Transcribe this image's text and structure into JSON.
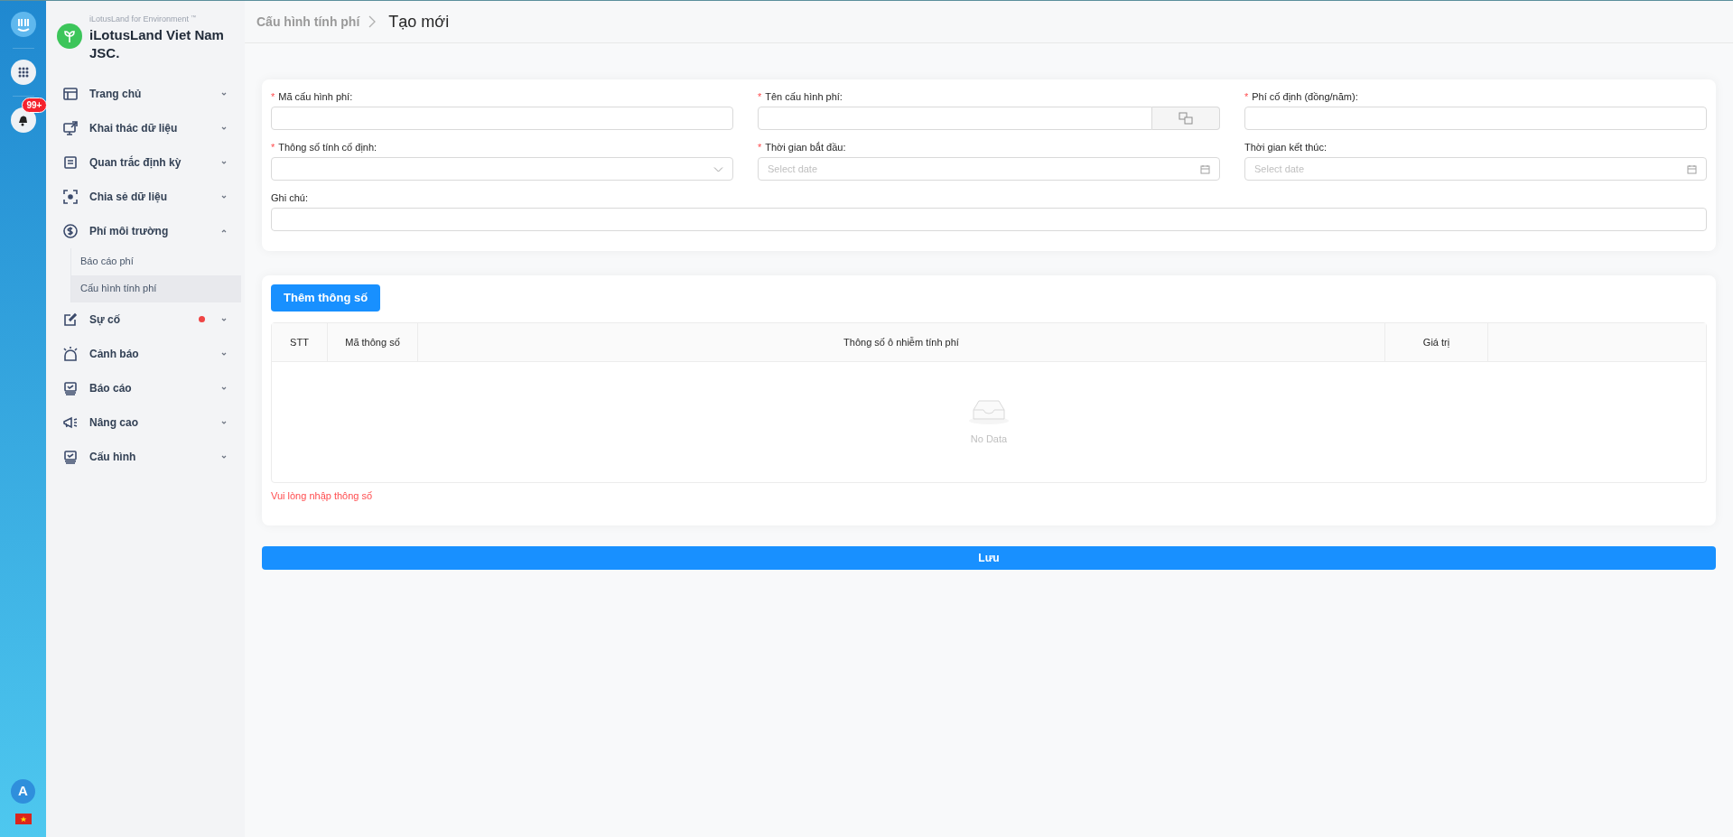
{
  "rail": {
    "notification_badge": "99+",
    "avatar": "A"
  },
  "sidebar": {
    "subtitle": "iLotusLand for Environment",
    "trademark": "™",
    "org": "iLotusLand Viet Nam JSC.",
    "items": [
      {
        "label": "Trang chủ",
        "expanded": false,
        "alert": false
      },
      {
        "label": "Khai thác dữ liệu",
        "expanded": false,
        "alert": false
      },
      {
        "label": "Quan trắc định kỳ",
        "expanded": false,
        "alert": false
      },
      {
        "label": "Chia sẻ dữ liệu",
        "expanded": false,
        "alert": false
      },
      {
        "label": "Phí môi trường",
        "expanded": true,
        "alert": false,
        "children": [
          {
            "label": "Báo cáo phí",
            "selected": false
          },
          {
            "label": "Cấu hình tính phí",
            "selected": true
          }
        ]
      },
      {
        "label": "Sự cố",
        "expanded": false,
        "alert": true
      },
      {
        "label": "Cảnh báo",
        "expanded": false,
        "alert": false
      },
      {
        "label": "Báo cáo",
        "expanded": false,
        "alert": false
      },
      {
        "label": "Nâng cao",
        "expanded": false,
        "alert": false
      },
      {
        "label": "Cấu hình",
        "expanded": false,
        "alert": false
      }
    ]
  },
  "breadcrumb": [
    "Cấu hình tính phí",
    "Tạo mới"
  ],
  "form": {
    "required_mark": "*",
    "fields": [
      {
        "label": "Mã cấu hình phí:",
        "required": true,
        "kind": "text"
      },
      {
        "label": "Tên cấu hình phí:",
        "required": true,
        "kind": "translate"
      },
      {
        "label": "Phí cố định (đồng/năm):",
        "required": true,
        "kind": "text"
      },
      {
        "label": "Thông số tính cố định:",
        "required": true,
        "kind": "select"
      },
      {
        "label": "Thời gian bắt đầu:",
        "required": true,
        "kind": "date",
        "placeholder": "Select date"
      },
      {
        "label": "Thời gian kết thúc:",
        "required": false,
        "kind": "date",
        "placeholder": "Select date"
      },
      {
        "label": "Ghi chú:",
        "required": false,
        "kind": "note"
      }
    ]
  },
  "params": {
    "add_button": "Thêm thông số",
    "table": {
      "columns": [
        "STT",
        "Mã thông số",
        "Thông số ô nhiễm tính phí",
        "Giá trị"
      ],
      "empty": "No Data"
    },
    "error": "Vui lòng nhập thông số"
  },
  "save_button": "Lưu"
}
